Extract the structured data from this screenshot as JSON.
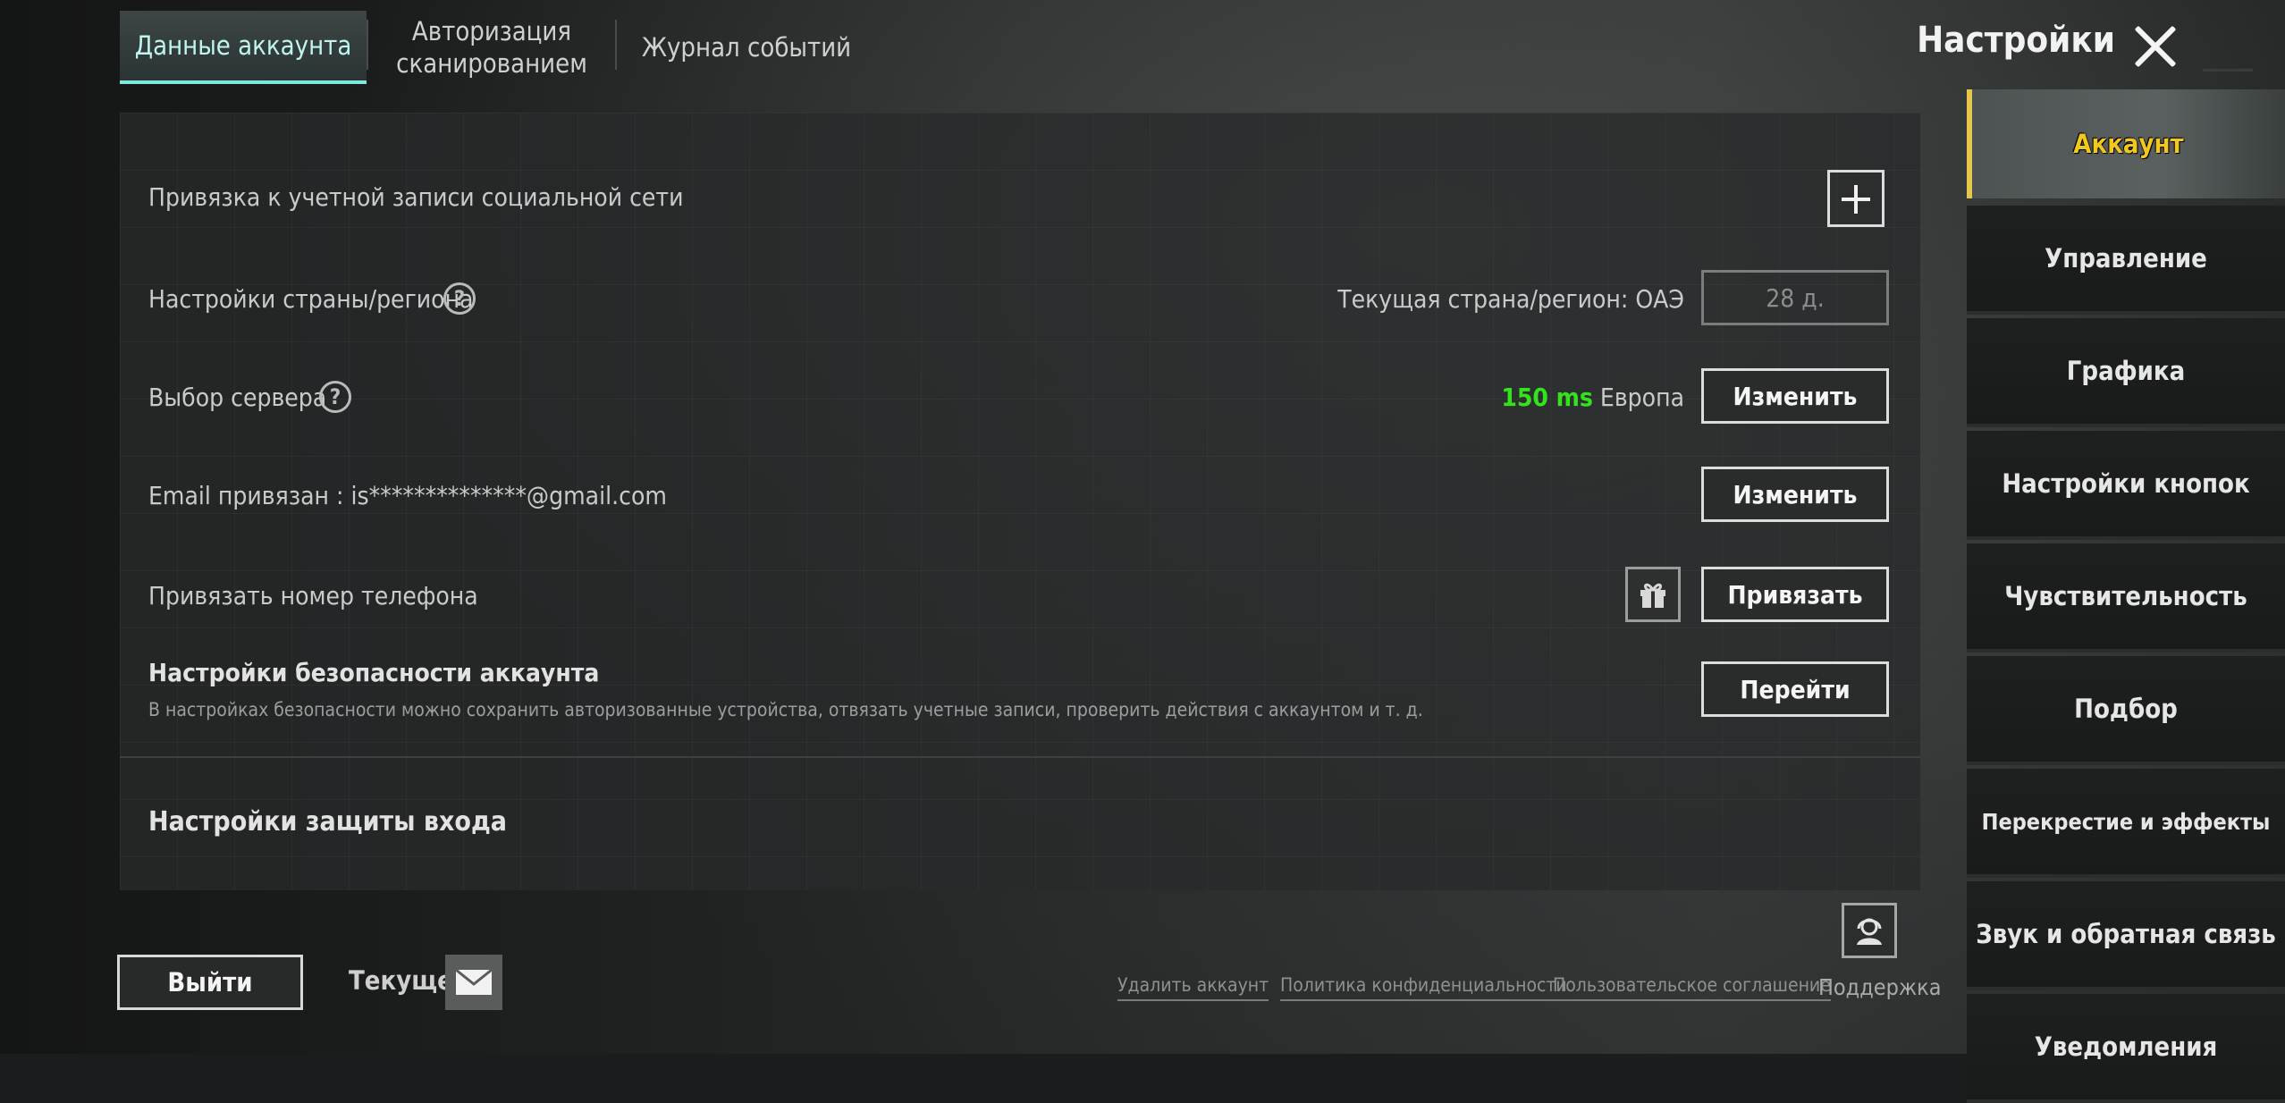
{
  "tabs": [
    {
      "label": "Данные аккаунта"
    },
    {
      "label": "Авторизация сканированием"
    },
    {
      "label": "Журнал событий"
    }
  ],
  "header": {
    "title": "Настройки"
  },
  "rows": {
    "social": {
      "label": "Привязка к учетной записи социальной сети"
    },
    "region": {
      "label": "Настройки страны/региона",
      "current": "Текущая страна/регион: ОАЭ",
      "box": "28 д."
    },
    "server": {
      "label": "Выбор сервера",
      "ping": "150 ms",
      "server_name": "Европа",
      "button": "Изменить"
    },
    "email": {
      "label": "Email привязан : is**************@gmail.com",
      "button": "Изменить"
    },
    "phone": {
      "label": "Привязать номер телефона",
      "button": "Привязать"
    },
    "security": {
      "label": "Настройки безопасности аккаунта",
      "description": "В настройках безопасности можно сохранить авторизованные устройства, отвязать учетные записи, проверить действия с аккаунтом и т. д.",
      "button": "Перейти"
    },
    "login_protection": {
      "label": "Настройки защиты входа"
    }
  },
  "sidebar": {
    "items": [
      {
        "label": "Аккаунт"
      },
      {
        "label": "Управление"
      },
      {
        "label": "Графика"
      },
      {
        "label": "Настройки кнопок"
      },
      {
        "label": "Чувствительность"
      },
      {
        "label": "Подбор"
      },
      {
        "label": "Перекрестие и эффекты"
      },
      {
        "label": "Звук и обратная связь"
      },
      {
        "label": "Уведомления"
      }
    ]
  },
  "footer": {
    "exit": "Выйти",
    "current": "Текущее",
    "links": [
      "Удалить аккаунт",
      "Политика конфиденциальности",
      "Пользовательское соглашение"
    ],
    "support": "Поддержка"
  },
  "colors": {
    "ping": "#33e31c",
    "active_tab": "#7fe7dc",
    "sidebar_active": "#f2c81f"
  }
}
